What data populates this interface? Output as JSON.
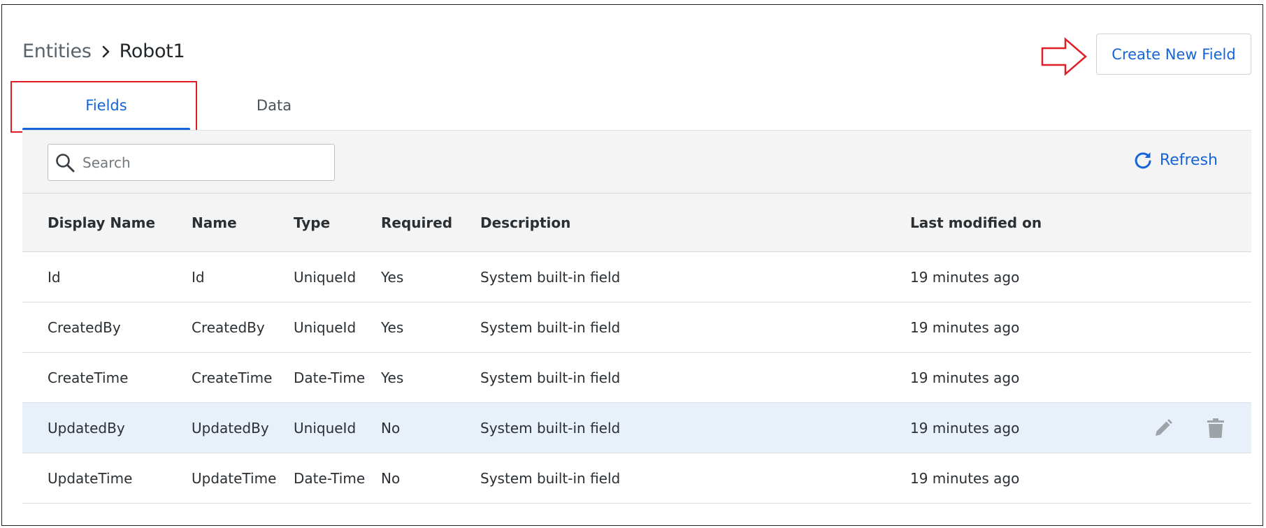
{
  "breadcrumb": {
    "parent": "Entities",
    "current": "Robot1"
  },
  "actions": {
    "create_field_label": "Create New Field",
    "refresh_label": "Refresh"
  },
  "tabs": [
    {
      "label": "Fields",
      "active": true
    },
    {
      "label": "Data",
      "active": false
    }
  ],
  "search": {
    "placeholder": "Search",
    "value": ""
  },
  "table": {
    "columns": [
      "Display Name",
      "Name",
      "Type",
      "Required",
      "Description",
      "Last modified on"
    ],
    "rows": [
      [
        "Id",
        "Id",
        "UniqueId",
        "Yes",
        "System built-in field",
        "19 minutes ago"
      ],
      [
        "CreatedBy",
        "CreatedBy",
        "UniqueId",
        "Yes",
        "System built-in field",
        "19 minutes ago"
      ],
      [
        "CreateTime",
        "CreateTime",
        "Date-Time",
        "Yes",
        "System built-in field",
        "19 minutes ago"
      ],
      [
        "UpdatedBy",
        "UpdatedBy",
        "UniqueId",
        "No",
        "System built-in field",
        "19 minutes ago"
      ],
      [
        "UpdateTime",
        "UpdateTime",
        "Date-Time",
        "No",
        "System built-in field",
        "19 minutes ago"
      ]
    ],
    "hovered_row_index": 3,
    "row_action_icons": [
      "pencil-icon",
      "trash-icon"
    ]
  },
  "colors": {
    "accent": "#1565d8",
    "annotation": "#e01c24",
    "header_bg": "#f4f4f4",
    "hover_row_bg": "#e8f0fa"
  }
}
